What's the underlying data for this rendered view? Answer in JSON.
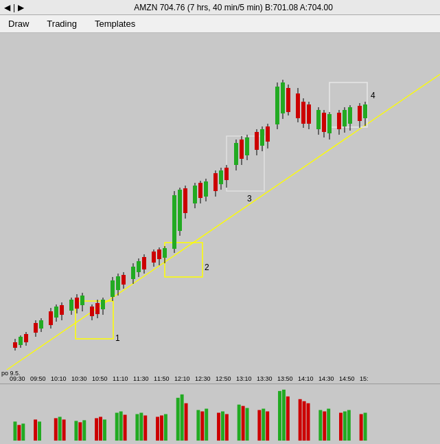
{
  "titlebar": {
    "title": "AMZN 704.76 (7 hrs, 40 min/5 min) B:701.08 A:704.00",
    "controls": [
      "back",
      "forward"
    ]
  },
  "menubar": {
    "items": [
      "Draw",
      "Trading",
      "Templates"
    ]
  },
  "chart": {
    "price_label": "po 9.5.",
    "time_labels": [
      "09:30",
      "09:50",
      "10:10",
      "10:30",
      "10:50",
      "11:10",
      "11:30",
      "11:50",
      "12:10",
      "12:30",
      "12:50",
      "13:10",
      "13:30",
      "13:50",
      "14:10",
      "14:30",
      "14:50",
      "15:"
    ],
    "annotations": [
      "1",
      "2",
      "3",
      "4"
    ]
  }
}
